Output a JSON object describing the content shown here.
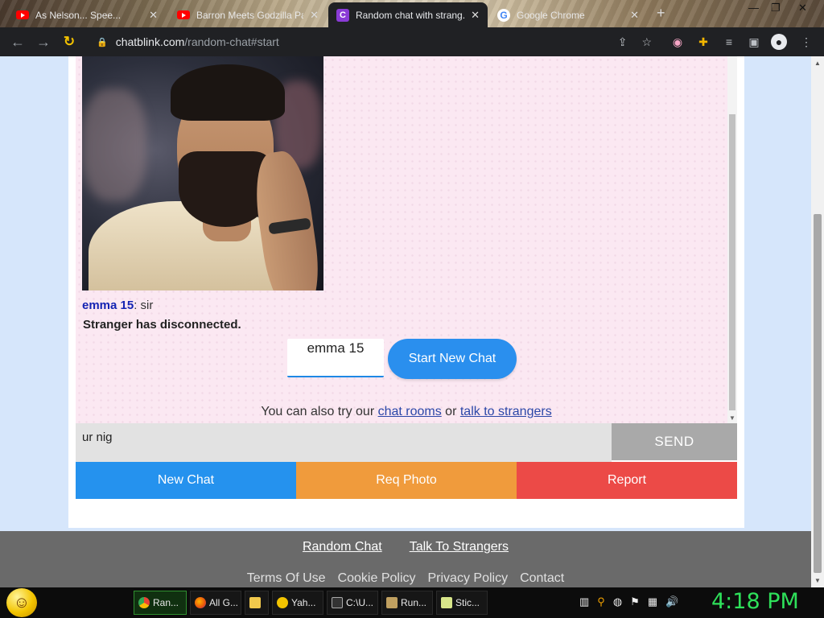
{
  "browser": {
    "tabs": [
      {
        "title": "As Nelson... Spee...",
        "icon": "youtube-icon"
      },
      {
        "title": "Barron Meets Godzilla Pa...",
        "icon": "youtube-icon"
      },
      {
        "title": "Random chat with strang...",
        "icon": "chatblink-icon",
        "active": true
      },
      {
        "title": "Google Chrome",
        "icon": "google-icon"
      }
    ],
    "new_tab": "+",
    "url_domain": "chatblink.com",
    "url_path": "/random-chat#start"
  },
  "chat": {
    "message": {
      "sender": "emma 15",
      "text": ": sir"
    },
    "system_message": "Stranger has disconnected.",
    "nickname_value": "emma 15",
    "start_button": "Start New Chat",
    "try_prefix": "You can also try our ",
    "try_link1": "chat rooms",
    "try_middle": " or ",
    "try_link2": "talk to strangers",
    "input_value": "ur nig",
    "send_label": "SEND",
    "actions": {
      "new_chat": "New Chat",
      "req_photo": "Req Photo",
      "report": "Report"
    }
  },
  "footer": {
    "links_primary": [
      "Random Chat",
      "Talk To Strangers"
    ],
    "links_secondary": [
      "Terms Of Use",
      "Cookie Policy",
      "Privacy Policy",
      "Contact"
    ]
  },
  "taskbar": {
    "items": [
      "Ran...",
      "All G...",
      "",
      "Yah...",
      "C:\\U...",
      "Run...",
      "Stic..."
    ],
    "clock": "4:18 PM"
  },
  "colors": {
    "new_chat": "#2592ee",
    "req_photo": "#f09b3c",
    "report": "#ec4a47",
    "start_button": "#2a8fee",
    "sender_name": "#1424b3",
    "clock": "#2ee05a"
  }
}
